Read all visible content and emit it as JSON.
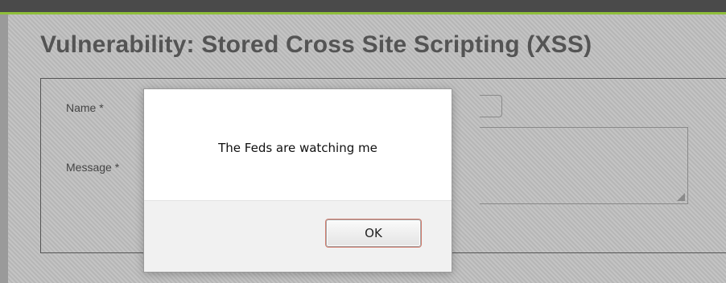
{
  "page": {
    "title": "Vulnerability: Stored Cross Site Scripting (XSS)"
  },
  "form": {
    "name_label": "Name *",
    "message_label": "Message *"
  },
  "alert": {
    "message": "The Feds are watching me",
    "ok_label": "OK"
  },
  "colors": {
    "topbar": "#4a4a4a",
    "accent": "#8fbf3a",
    "title_text": "#545454",
    "background": "#bdbdbd"
  }
}
